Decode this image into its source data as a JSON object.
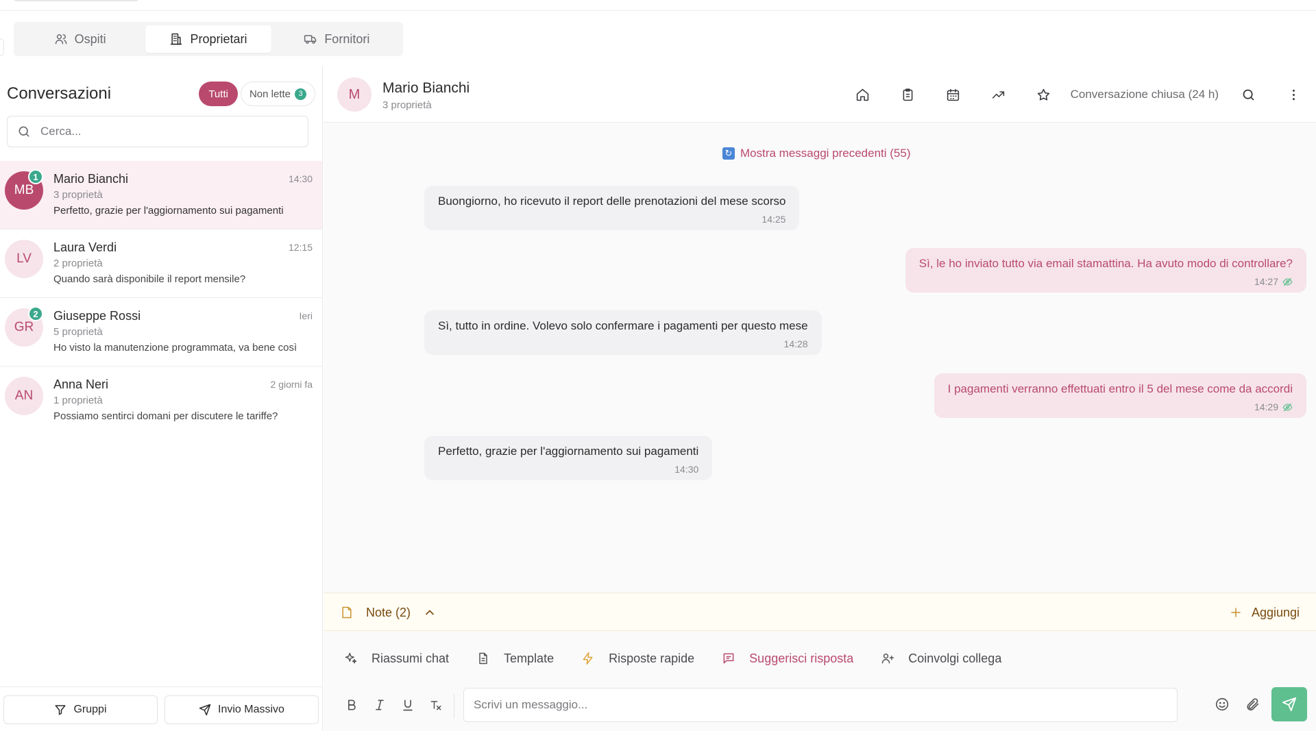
{
  "tabs": [
    {
      "label": "Ospiti",
      "icon": "users-icon",
      "active": false
    },
    {
      "label": "Proprietari",
      "icon": "building-icon",
      "active": true
    },
    {
      "label": "Fornitori",
      "icon": "truck-icon",
      "active": false
    }
  ],
  "sidebar": {
    "title": "Conversazioni",
    "filter_all": "Tutti",
    "filter_unread": "Non lette",
    "unread_count": "3",
    "search_placeholder": "Cerca...",
    "conversations": [
      {
        "initials": "MB",
        "name": "Mario Bianchi",
        "time": "14:30",
        "subtitle": "3 proprietà",
        "preview": "Perfetto, grazie per l'aggiornamento sui pagamenti",
        "badge": "1",
        "active": true
      },
      {
        "initials": "LV",
        "name": "Laura Verdi",
        "time": "12:15",
        "subtitle": "2 proprietà",
        "preview": "Quando sarà disponibile il report mensile?",
        "badge": "",
        "active": false
      },
      {
        "initials": "GR",
        "name": "Giuseppe Rossi",
        "time": "Ieri",
        "subtitle": "5 proprietà",
        "preview": "Ho visto la manutenzione programmata, va bene così",
        "badge": "2",
        "active": false
      },
      {
        "initials": "AN",
        "name": "Anna Neri",
        "time": "2 giorni fa",
        "subtitle": "1 proprietà",
        "preview": "Possiamo sentirci domani per discutere le tariffe?",
        "badge": "",
        "active": false
      }
    ],
    "footer": {
      "groups_label": "Gruppi",
      "bulk_label": "Invio Massivo"
    }
  },
  "chat": {
    "avatar_initial": "M",
    "name": "Mario Bianchi",
    "subtitle": "3 proprietà",
    "status": "Conversazione chiusa (24 h)",
    "header_icons": [
      "home-icon",
      "clipboard-icon",
      "calendar-icon",
      "trending-up-icon",
      "star-icon",
      "search-icon",
      "more-vertical-icon"
    ],
    "load_more": "Mostra messaggi precedenti (55)",
    "messages": [
      {
        "direction": "in",
        "text": "Buongiorno, ho ricevuto il report delle prenotazioni del mese scorso",
        "time": "14:25"
      },
      {
        "direction": "out",
        "text": "Sì, le ho inviato tutto via email stamattina. Ha avuto modo di controllare?",
        "time": "14:27"
      },
      {
        "direction": "in",
        "text": "Sì, tutto in ordine. Volevo solo confermare i pagamenti per questo mese",
        "time": "14:28"
      },
      {
        "direction": "out",
        "text": "I pagamenti verranno effettuati entro il 5 del mese come da accordi",
        "time": "14:29"
      },
      {
        "direction": "in",
        "text": "Perfetto, grazie per l'aggiornamento sui pagamenti",
        "time": "14:30"
      }
    ]
  },
  "notes": {
    "label": "Note (2)",
    "add_label": "Aggiungi"
  },
  "toolbar": {
    "summarize": "Riassumi chat",
    "template": "Template",
    "quick_replies": "Risposte rapide",
    "suggest": "Suggerisci risposta",
    "colleague": "Coinvolgi collega"
  },
  "composer": {
    "placeholder": "Scrivi un messaggio..."
  },
  "colors": {
    "accent": "#b94a6e",
    "success": "#3aa88c",
    "send": "#5fbf8f",
    "notes": "#7a4a0e"
  }
}
